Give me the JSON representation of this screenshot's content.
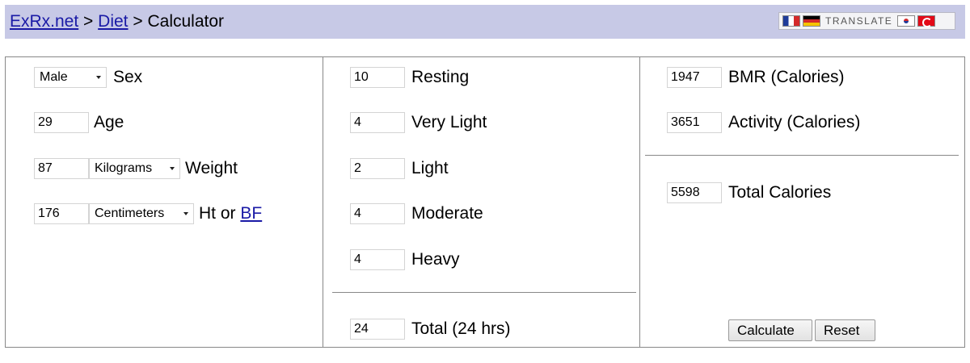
{
  "breadcrumb": {
    "site": "ExRx.net",
    "sep1": ">",
    "section": "Diet",
    "sep2": ">",
    "page": "Calculator"
  },
  "translate": {
    "label": "TRANSLATE",
    "flags": [
      "france-flag-icon",
      "germany-flag-icon",
      "korea-flag-icon",
      "turkey-flag-icon"
    ]
  },
  "profile": {
    "sex": {
      "value": "Male",
      "label": "Sex"
    },
    "age": {
      "value": "29",
      "label": "Age"
    },
    "weight": {
      "value": "87",
      "unit": "Kilograms",
      "label": "Weight"
    },
    "height": {
      "value": "176",
      "unit": "Centimeters",
      "label_prefix": "Ht or",
      "link": "BF"
    }
  },
  "activity": {
    "resting": {
      "value": "10",
      "label": "Resting"
    },
    "very_light": {
      "value": "4",
      "label": "Very Light"
    },
    "light": {
      "value": "2",
      "label": "Light"
    },
    "moderate": {
      "value": "4",
      "label": "Moderate"
    },
    "heavy": {
      "value": "4",
      "label": "Heavy"
    },
    "total": {
      "value": "24",
      "label": "Total (24 hrs)"
    }
  },
  "results": {
    "bmr": {
      "value": "1947",
      "label": "BMR (Calories)"
    },
    "activity": {
      "value": "3651",
      "label": "Activity (Calories)"
    },
    "total": {
      "value": "5598",
      "label": "Total Calories"
    }
  },
  "buttons": {
    "calculate": "Calculate",
    "reset": "Reset"
  },
  "colors": {
    "header_bg": "#c7c9e6",
    "link": "#1a1aa6"
  }
}
